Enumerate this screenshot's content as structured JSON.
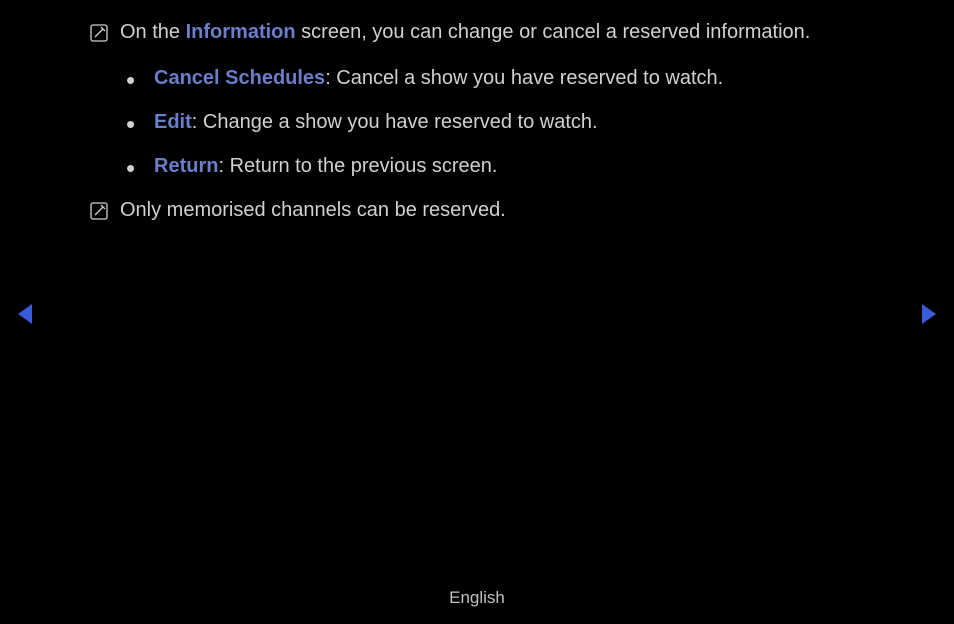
{
  "note1": {
    "prefix": "On the ",
    "highlight": "Information",
    "suffix": " screen, you can change or cancel a reserved information."
  },
  "bullets": [
    {
      "label": "Cancel Schedules",
      "desc": ": Cancel a show you have reserved to watch."
    },
    {
      "label": "Edit",
      "desc": ": Change a show you have reserved to watch."
    },
    {
      "label": "Return",
      "desc": ": Return to the previous screen."
    }
  ],
  "note2": "Only memorised channels can be reserved.",
  "footer": "English"
}
